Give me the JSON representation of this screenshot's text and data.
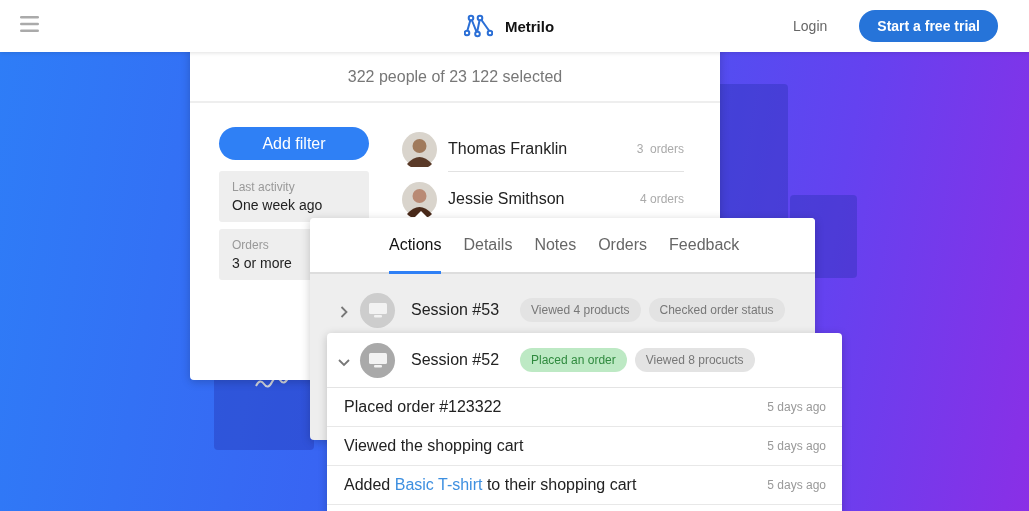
{
  "header": {
    "logo": "Metrilo",
    "login": "Login",
    "cta": "Start a free trial"
  },
  "selection_summary": "322 people of 23 122 selected",
  "add_filter": "Add filter",
  "filters": [
    {
      "label": "Last activity",
      "value": "One week ago"
    },
    {
      "label": "Orders",
      "value": "3 or more"
    }
  ],
  "people": [
    {
      "name": "Thomas Franklin",
      "orders": "3  orders"
    },
    {
      "name": "Jessie Smithson",
      "orders": "4 orders"
    }
  ],
  "tabs": [
    {
      "label": "Actions",
      "selected": true
    },
    {
      "label": "Details",
      "selected": false
    },
    {
      "label": "Notes",
      "selected": false
    },
    {
      "label": "Orders",
      "selected": false
    },
    {
      "label": "Feedback",
      "selected": false
    }
  ],
  "sessions": [
    {
      "title": "Session #53",
      "expanded": false,
      "tags": [
        {
          "label": "Viewed 4 products",
          "kind": "neutral"
        },
        {
          "label": "Checked order status",
          "kind": "neutral"
        }
      ]
    },
    {
      "title": "Session #52",
      "expanded": true,
      "tags": [
        {
          "label": "Placed an order",
          "kind": "success"
        },
        {
          "label": "Viewed 8 procucts",
          "kind": "neutral"
        }
      ],
      "events": [
        {
          "segments": [
            {
              "kind": "plain",
              "text": "Placed order #123322"
            }
          ],
          "time": "5 days ago"
        },
        {
          "segments": [
            {
              "kind": "plain",
              "text": "Viewed the shopping cart"
            }
          ],
          "time": "5 days ago"
        },
        {
          "segments": [
            {
              "kind": "plain",
              "text": "Added "
            },
            {
              "kind": "link",
              "text": "Basic T-shirt"
            },
            {
              "kind": "plain",
              "text": " to their shopping cart"
            }
          ],
          "time": "5 days ago"
        }
      ]
    }
  ]
}
